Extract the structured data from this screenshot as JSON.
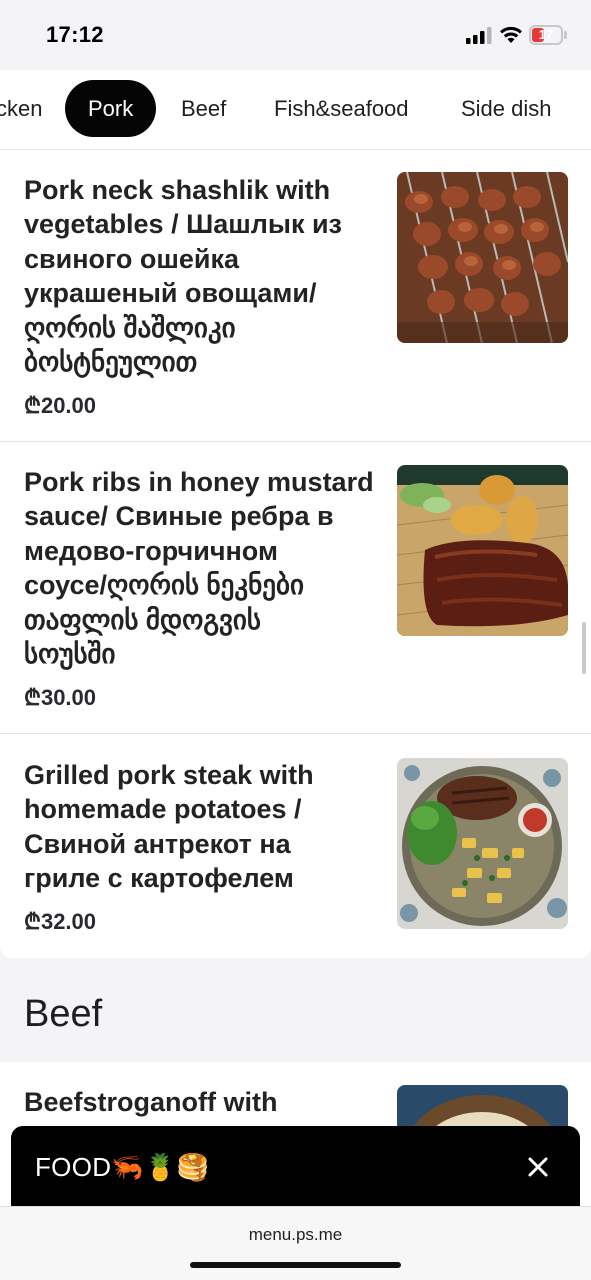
{
  "status_bar": {
    "time": "17:12",
    "battery": "17"
  },
  "tabs": [
    {
      "label": "cken",
      "active": false
    },
    {
      "label": "Pork",
      "active": true
    },
    {
      "label": "Beef",
      "active": false
    },
    {
      "label": "Fish&seafood",
      "active": false
    },
    {
      "label": "Side dish",
      "active": false
    }
  ],
  "items": [
    {
      "name_lines": [
        "Pork neck shashlik with",
        "vegetables / Шашлык из",
        "свиного ошейка",
        "украшеный овощами/",
        "ღორის შაშლიკი",
        "ბოსტნეულით"
      ],
      "price": "₾20.00"
    },
    {
      "name_lines": [
        "Pork ribs in honey mustard",
        "sauce/ Свиные ребра в",
        "медово-горчичном",
        "соусе/ღორის ნეკნები",
        "თაფლის მდოგვის",
        "სოუსში"
      ],
      "price": "₾30.00"
    },
    {
      "name_lines": [
        "Grilled pork steak with",
        "homemade potatoes /",
        "Свиной антрекот на",
        "гриле с картофелем"
      ],
      "price": "₾32.00"
    }
  ],
  "section": {
    "title": "Beef"
  },
  "next_item": {
    "name": "Beefstroganoff with"
  },
  "banner": {
    "text": "FOOD🦐🍍🥞"
  },
  "browser": {
    "url": "menu.ps.me"
  },
  "colors": {
    "accent": "#050505",
    "background": "#f4f4f6",
    "card": "#ffffff"
  }
}
